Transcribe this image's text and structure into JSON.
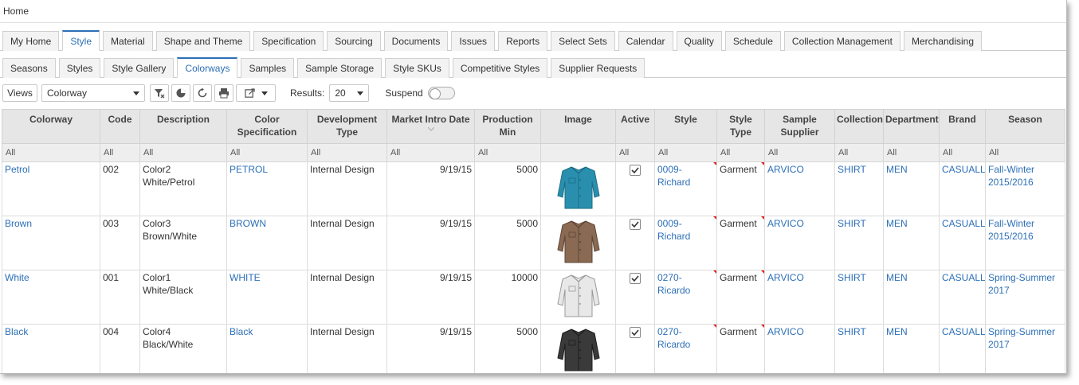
{
  "breadcrumb": "Home",
  "main_tabs": [
    "My Home",
    "Style",
    "Material",
    "Shape and Theme",
    "Specification",
    "Sourcing",
    "Documents",
    "Issues",
    "Reports",
    "Select Sets",
    "Calendar",
    "Quality",
    "Schedule",
    "Collection Management",
    "Merchandising"
  ],
  "main_active": "Style",
  "sub_tabs": [
    "Seasons",
    "Styles",
    "Style Gallery",
    "Colorways",
    "Samples",
    "Sample Storage",
    "Style SKUs",
    "Competitive Styles",
    "Supplier Requests"
  ],
  "sub_active": "Colorways",
  "toolbar": {
    "views_label": "Views",
    "view_select": "Colorway",
    "results_label": "Results:",
    "results_value": "20",
    "suspend_label": "Suspend",
    "icons": [
      "clear-filter-icon",
      "pie-chart-icon",
      "refresh-icon",
      "print-icon",
      "export-icon"
    ]
  },
  "columns": [
    {
      "key": "colorway",
      "label": "Colorway"
    },
    {
      "key": "code",
      "label": "Code"
    },
    {
      "key": "description",
      "label": "Description"
    },
    {
      "key": "color_spec",
      "label": "Color Specification"
    },
    {
      "key": "dev_type",
      "label": "Development Type"
    },
    {
      "key": "market_intro",
      "label": "Market Intro Date"
    },
    {
      "key": "prod_min",
      "label": "Production Min"
    },
    {
      "key": "image",
      "label": "Image"
    },
    {
      "key": "active",
      "label": "Active"
    },
    {
      "key": "style",
      "label": "Style"
    },
    {
      "key": "style_type",
      "label": "Style Type"
    },
    {
      "key": "sample_supplier",
      "label": "Sample Supplier"
    },
    {
      "key": "collection",
      "label": "Collection"
    },
    {
      "key": "department",
      "label": "Department"
    },
    {
      "key": "brand",
      "label": "Brand"
    },
    {
      "key": "season",
      "label": "Season"
    }
  ],
  "filter_all": "All",
  "rows": [
    {
      "colorway": "Petrol",
      "code": "002",
      "description": "Color2 White/Petrol",
      "color_spec": "PETROL",
      "dev_type": "Internal Design",
      "market_intro": "9/19/15",
      "prod_min": "5000",
      "shirt_color": "#2a8fae",
      "shirt_dark": "#1d6c86",
      "active": true,
      "style": "0009-Richard",
      "style_type": "Garment",
      "sample_supplier": "ARVICO",
      "collection": "SHIRT",
      "department": "MEN",
      "brand": "CASUALLY",
      "season": "Fall-Winter 2015/2016"
    },
    {
      "colorway": "Brown",
      "code": "003",
      "description": "Color3 Brown/White",
      "color_spec": "BROWN",
      "dev_type": "Internal Design",
      "market_intro": "9/19/15",
      "prod_min": "5000",
      "shirt_color": "#8a6a52",
      "shirt_dark": "#5e4535",
      "active": true,
      "style": "0009-Richard",
      "style_type": "Garment",
      "sample_supplier": "ARVICO",
      "collection": "SHIRT",
      "department": "MEN",
      "brand": "CASUALLY",
      "season": "Fall-Winter 2015/2016"
    },
    {
      "colorway": "White",
      "code": "001",
      "description": "Color1 White/Black",
      "color_spec": "WHITE",
      "dev_type": "Internal Design",
      "market_intro": "9/19/15",
      "prod_min": "10000",
      "shirt_color": "#e8e8e8",
      "shirt_dark": "#9a9a9a",
      "active": true,
      "style": "0270-Ricardo",
      "style_type": "Garment",
      "sample_supplier": "ARVICO",
      "collection": "SHIRT",
      "department": "MEN",
      "brand": "CASUALLY",
      "season": "Spring-Summer 2017"
    },
    {
      "colorway": "Black",
      "code": "004",
      "description": "Color4 Black/White",
      "color_spec": "Black",
      "dev_type": "Internal Design",
      "market_intro": "9/19/15",
      "prod_min": "5000",
      "shirt_color": "#3a3a3a",
      "shirt_dark": "#1e1e1e",
      "active": true,
      "style": "0270-Ricardo",
      "style_type": "Garment",
      "sample_supplier": "ARVICO",
      "collection": "SHIRT",
      "department": "MEN",
      "brand": "CASUALLY",
      "season": "Spring-Summer 2017"
    }
  ],
  "colors": {
    "accent": "#2c6fb7",
    "header_bg": "#e6e6e6"
  }
}
